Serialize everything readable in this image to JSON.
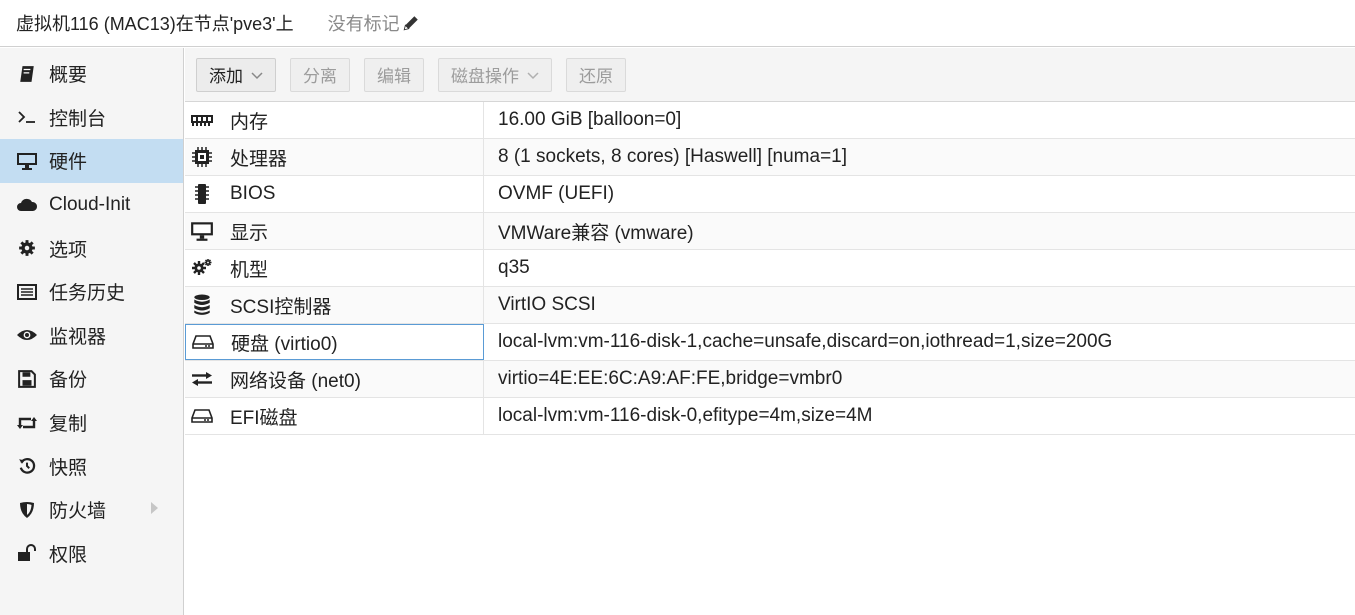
{
  "header": {
    "title": "虚拟机116 (MAC13)在节点'pve3'上",
    "tags_label": "没有标记"
  },
  "sidebar": {
    "items": [
      {
        "label": "概要",
        "icon": "book-icon"
      },
      {
        "label": "控制台",
        "icon": "terminal-icon"
      },
      {
        "label": "硬件",
        "icon": "monitor-icon",
        "active": true
      },
      {
        "label": "Cloud-Init",
        "icon": "cloud-icon"
      },
      {
        "label": "选项",
        "icon": "gear-icon"
      },
      {
        "label": "任务历史",
        "icon": "list-icon"
      },
      {
        "label": "监视器",
        "icon": "eye-icon"
      },
      {
        "label": "备份",
        "icon": "floppy-icon"
      },
      {
        "label": "复制",
        "icon": "retweet-icon"
      },
      {
        "label": "快照",
        "icon": "history-icon"
      },
      {
        "label": "防火墙",
        "icon": "shield-icon",
        "has_submenu": true
      },
      {
        "label": "权限",
        "icon": "unlock-icon"
      }
    ]
  },
  "toolbar": {
    "add_label": "添加",
    "detach_label": "分离",
    "edit_label": "编辑",
    "disk_action_label": "磁盘操作",
    "revert_label": "还原"
  },
  "hardware": {
    "rows": [
      {
        "key": "内存",
        "value": "16.00 GiB [balloon=0]",
        "icon": "memory-icon"
      },
      {
        "key": "处理器",
        "value": "8 (1 sockets, 8 cores) [Haswell] [numa=1]",
        "icon": "cpu-icon"
      },
      {
        "key": "BIOS",
        "value": "OVMF (UEFI)",
        "icon": "microchip-icon"
      },
      {
        "key": "显示",
        "value": "VMWare兼容 (vmware)",
        "icon": "desktop-icon"
      },
      {
        "key": "机型",
        "value": "q35",
        "icon": "cogs-icon"
      },
      {
        "key": "SCSI控制器",
        "value": "VirtIO SCSI",
        "icon": "database-icon"
      },
      {
        "key": "硬盘 (virtio0)",
        "value": "local-lvm:vm-116-disk-1,cache=unsafe,discard=on,iothread=1,size=200G",
        "icon": "hdd-icon",
        "selected": true
      },
      {
        "key": "网络设备 (net0)",
        "value": "virtio=4E:EE:6C:A9:AF:FE,bridge=vmbr0",
        "icon": "exchange-icon"
      },
      {
        "key": "EFI磁盘",
        "value": "local-lvm:vm-116-disk-0,efitype=4m,size=4M",
        "icon": "hdd-icon"
      }
    ]
  }
}
